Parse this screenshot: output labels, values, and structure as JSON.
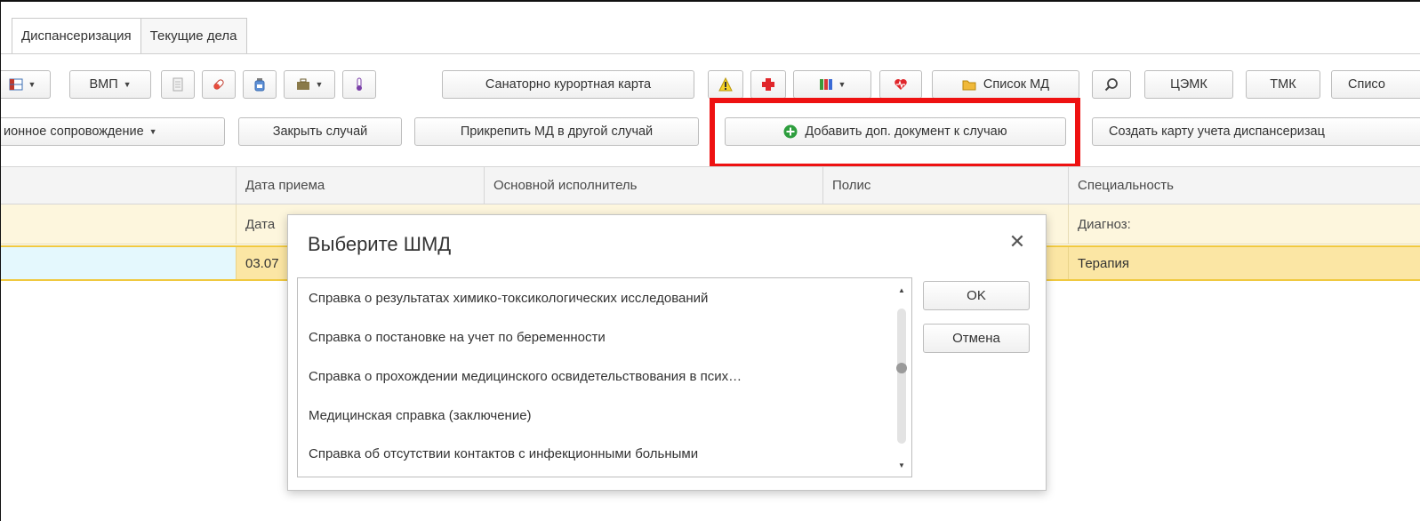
{
  "tabs": [
    {
      "label": "Диспансеризация"
    },
    {
      "label": "Текущие дела"
    }
  ],
  "toolbar1": {
    "vmp_label": "ВМП",
    "sanatorium_label": "Санаторно курортная карта",
    "md_list_label": "Список МД",
    "cemk_label": "ЦЭМК",
    "tmk_label": "ТМК",
    "list_cut_label": "Списо"
  },
  "toolbar2": {
    "support_label": "ионное сопровождение",
    "close_case_label": "Закрыть случай",
    "attach_md_label": "Прикрепить МД в другой случай",
    "add_doc_label": "Добавить доп. документ  к случаю",
    "create_card_label": "Создать карту учета диспансеризац"
  },
  "grid": {
    "headers": [
      "Дата приема",
      "Основной исполнитель",
      "Полис",
      "Специальность"
    ],
    "sub": {
      "date_label": "Дата",
      "diagnosis_label": "Диагноз:"
    },
    "row": {
      "date": "03.07",
      "specialty": "Терапия"
    }
  },
  "dialog": {
    "title": "Выберите ШМД",
    "close_glyph": "✕",
    "items": [
      "Справка о результатах химико-токсикологических исследований",
      "Справка о постановке на учет по беременности",
      "Справка о прохождении медицинского освидетельствования в псих…",
      "Медицинская справка (заключение)",
      "Справка об отсутствии контактов с инфекционными больными"
    ],
    "ok_label": "OK",
    "cancel_label": "Отмена"
  },
  "colors": {
    "highlight": "#ee1111",
    "selected_row": "#fbe6a4",
    "add_icon": "#2e9e3e"
  }
}
